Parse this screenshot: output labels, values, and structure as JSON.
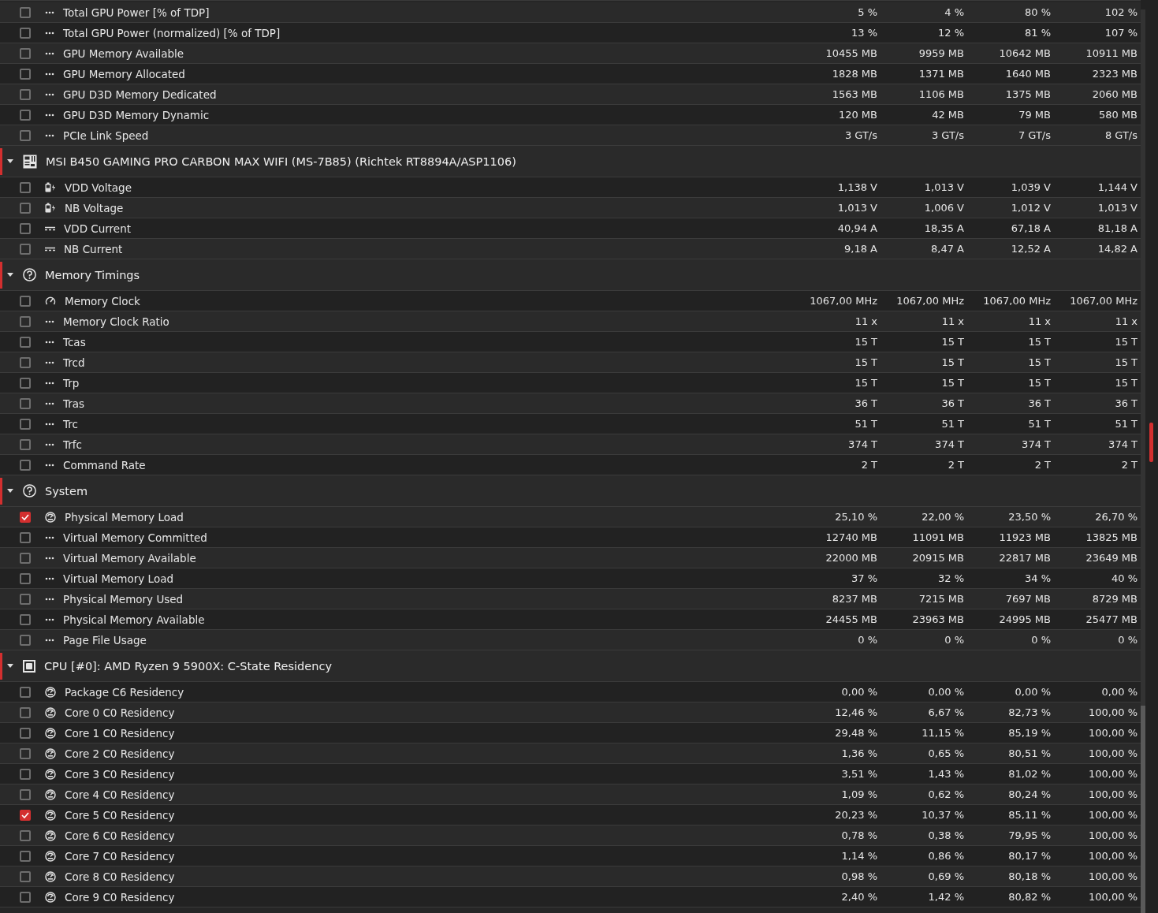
{
  "groups": [
    {
      "rows": [
        {
          "label": "Total GPU Power [% of TDP]",
          "kind": "dots",
          "checked": false,
          "values": [
            "5 %",
            "4 %",
            "80 %",
            "102 %"
          ]
        },
        {
          "label": "Total GPU Power (normalized) [% of TDP]",
          "kind": "dots",
          "checked": false,
          "values": [
            "13 %",
            "12 %",
            "81 %",
            "107 %"
          ]
        },
        {
          "label": "GPU Memory Available",
          "kind": "dots",
          "checked": false,
          "values": [
            "10455 MB",
            "9959 MB",
            "10642 MB",
            "10911 MB"
          ]
        },
        {
          "label": "GPU Memory Allocated",
          "kind": "dots",
          "checked": false,
          "values": [
            "1828 MB",
            "1371 MB",
            "1640 MB",
            "2323 MB"
          ]
        },
        {
          "label": "GPU D3D Memory Dedicated",
          "kind": "dots",
          "checked": false,
          "values": [
            "1563 MB",
            "1106 MB",
            "1375 MB",
            "2060 MB"
          ]
        },
        {
          "label": "GPU D3D Memory Dynamic",
          "kind": "dots",
          "checked": false,
          "values": [
            "120 MB",
            "42 MB",
            "79 MB",
            "580 MB"
          ]
        },
        {
          "label": "PCIe Link Speed",
          "kind": "dots",
          "checked": false,
          "values": [
            "3 GT/s",
            "3 GT/s",
            "7 GT/s",
            "8 GT/s"
          ]
        }
      ]
    },
    {
      "title": "MSI B450 GAMING PRO CARBON MAX WIFI (MS-7B85) (Richtek RT8894A/ASP1106)",
      "kind": "board",
      "expanded": true,
      "rows": [
        {
          "label": "VDD Voltage",
          "kind": "voltage",
          "checked": false,
          "values": [
            "1,138 V",
            "1,013 V",
            "1,039 V",
            "1,144 V"
          ]
        },
        {
          "label": "NB Voltage",
          "kind": "voltage",
          "checked": false,
          "values": [
            "1,013 V",
            "1,006 V",
            "1,012 V",
            "1,013 V"
          ]
        },
        {
          "label": "VDD Current",
          "kind": "current",
          "checked": false,
          "values": [
            "40,94 A",
            "18,35 A",
            "67,18 A",
            "81,18 A"
          ]
        },
        {
          "label": "NB Current",
          "kind": "current",
          "checked": false,
          "values": [
            "9,18 A",
            "8,47 A",
            "12,52 A",
            "14,82 A"
          ]
        }
      ]
    },
    {
      "title": "Memory Timings",
      "kind": "other",
      "expanded": true,
      "rows": [
        {
          "label": "Memory Clock",
          "kind": "clock",
          "checked": false,
          "values": [
            "1067,00 MHz",
            "1067,00 MHz",
            "1067,00 MHz",
            "1067,00 MHz"
          ]
        },
        {
          "label": "Memory Clock Ratio",
          "kind": "dots",
          "checked": false,
          "values": [
            "11 x",
            "11 x",
            "11 x",
            "11 x"
          ]
        },
        {
          "label": "Tcas",
          "kind": "dots",
          "checked": false,
          "values": [
            "15 T",
            "15 T",
            "15 T",
            "15 T"
          ]
        },
        {
          "label": "Trcd",
          "kind": "dots",
          "checked": false,
          "values": [
            "15 T",
            "15 T",
            "15 T",
            "15 T"
          ]
        },
        {
          "label": "Trp",
          "kind": "dots",
          "checked": false,
          "values": [
            "15 T",
            "15 T",
            "15 T",
            "15 T"
          ]
        },
        {
          "label": "Tras",
          "kind": "dots",
          "checked": false,
          "values": [
            "36 T",
            "36 T",
            "36 T",
            "36 T"
          ]
        },
        {
          "label": "Trc",
          "kind": "dots",
          "checked": false,
          "values": [
            "51 T",
            "51 T",
            "51 T",
            "51 T"
          ]
        },
        {
          "label": "Trfc",
          "kind": "dots",
          "checked": false,
          "values": [
            "374 T",
            "374 T",
            "374 T",
            "374 T"
          ]
        },
        {
          "label": "Command Rate",
          "kind": "dots",
          "checked": false,
          "values": [
            "2 T",
            "2 T",
            "2 T",
            "2 T"
          ]
        }
      ]
    },
    {
      "title": "System",
      "kind": "other",
      "expanded": true,
      "rows": [
        {
          "label": "Physical Memory Load",
          "kind": "load",
          "checked": true,
          "values": [
            "25,10 %",
            "22,00 %",
            "23,50 %",
            "26,70 %"
          ]
        },
        {
          "label": "Virtual Memory Committed",
          "kind": "dots",
          "checked": false,
          "values": [
            "12740 MB",
            "11091 MB",
            "11923 MB",
            "13825 MB"
          ]
        },
        {
          "label": "Virtual Memory Available",
          "kind": "dots",
          "checked": false,
          "values": [
            "22000 MB",
            "20915 MB",
            "22817 MB",
            "23649 MB"
          ]
        },
        {
          "label": "Virtual Memory Load",
          "kind": "dots",
          "checked": false,
          "values": [
            "37 %",
            "32 %",
            "34 %",
            "40 %"
          ]
        },
        {
          "label": "Physical Memory Used",
          "kind": "dots",
          "checked": false,
          "values": [
            "8237 MB",
            "7215 MB",
            "7697 MB",
            "8729 MB"
          ]
        },
        {
          "label": "Physical Memory Available",
          "kind": "dots",
          "checked": false,
          "values": [
            "24455 MB",
            "23963 MB",
            "24995 MB",
            "25477 MB"
          ]
        },
        {
          "label": "Page File Usage",
          "kind": "dots",
          "checked": false,
          "values": [
            "0 %",
            "0 %",
            "0 %",
            "0 %"
          ]
        }
      ]
    },
    {
      "title": "CPU [#0]: AMD Ryzen 9 5900X: C-State Residency",
      "kind": "cpu",
      "expanded": true,
      "rows": [
        {
          "label": "Package C6 Residency",
          "kind": "load",
          "checked": false,
          "values": [
            "0,00 %",
            "0,00 %",
            "0,00 %",
            "0,00 %"
          ]
        },
        {
          "label": "Core 0 C0 Residency",
          "kind": "load",
          "checked": false,
          "values": [
            "12,46 %",
            "6,67 %",
            "82,73 %",
            "100,00 %"
          ]
        },
        {
          "label": "Core 1 C0 Residency",
          "kind": "load",
          "checked": false,
          "values": [
            "29,48 %",
            "11,15 %",
            "85,19 %",
            "100,00 %"
          ]
        },
        {
          "label": "Core 2 C0 Residency",
          "kind": "load",
          "checked": false,
          "values": [
            "1,36 %",
            "0,65 %",
            "80,51 %",
            "100,00 %"
          ]
        },
        {
          "label": "Core 3 C0 Residency",
          "kind": "load",
          "checked": false,
          "values": [
            "3,51 %",
            "1,43 %",
            "81,02 %",
            "100,00 %"
          ]
        },
        {
          "label": "Core 4 C0 Residency",
          "kind": "load",
          "checked": false,
          "values": [
            "1,09 %",
            "0,62 %",
            "80,24 %",
            "100,00 %"
          ]
        },
        {
          "label": "Core 5 C0 Residency",
          "kind": "load",
          "checked": true,
          "values": [
            "20,23 %",
            "10,37 %",
            "85,11 %",
            "100,00 %"
          ]
        },
        {
          "label": "Core 6 C0 Residency",
          "kind": "load",
          "checked": false,
          "values": [
            "0,78 %",
            "0,38 %",
            "79,95 %",
            "100,00 %"
          ]
        },
        {
          "label": "Core 7 C0 Residency",
          "kind": "load",
          "checked": false,
          "values": [
            "1,14 %",
            "0,86 %",
            "80,17 %",
            "100,00 %"
          ]
        },
        {
          "label": "Core 8 C0 Residency",
          "kind": "load",
          "checked": false,
          "values": [
            "0,98 %",
            "0,69 %",
            "80,18 %",
            "100,00 %"
          ]
        },
        {
          "label": "Core 9 C0 Residency",
          "kind": "load",
          "checked": false,
          "values": [
            "2,40 %",
            "1,42 %",
            "80,82 %",
            "100,00 %"
          ]
        }
      ]
    }
  ]
}
